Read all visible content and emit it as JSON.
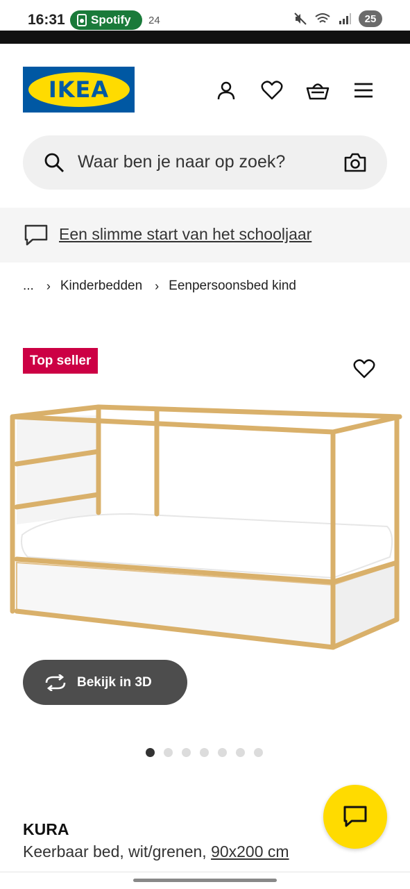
{
  "status_bar": {
    "time": "16:31",
    "app_pill": "Spotify",
    "notif_count": "24",
    "battery": "25"
  },
  "header": {
    "logo_text": "IKEA",
    "icons": [
      "account-icon",
      "heart-icon",
      "basket-icon",
      "menu-icon"
    ]
  },
  "search": {
    "placeholder": "Waar ben je naar op zoek?"
  },
  "promo": {
    "text": "Een slimme start van het schooljaar"
  },
  "breadcrumb": {
    "ellipsis": "...",
    "items": [
      "Kinderbedden",
      "Eenpersoonsbed kind"
    ]
  },
  "product": {
    "badge": "Top seller",
    "view_3d_label": "Bekijk in 3D",
    "image_count": 7,
    "active_image": 1,
    "name": "KURA",
    "description": "Keerbaar bed, wit/grenen,",
    "size": "90x200 cm"
  },
  "colors": {
    "ikea_blue": "#0058a3",
    "ikea_yellow": "#ffdb00",
    "badge_red": "#cc0044",
    "spotify_green": "#1a7a3a"
  }
}
